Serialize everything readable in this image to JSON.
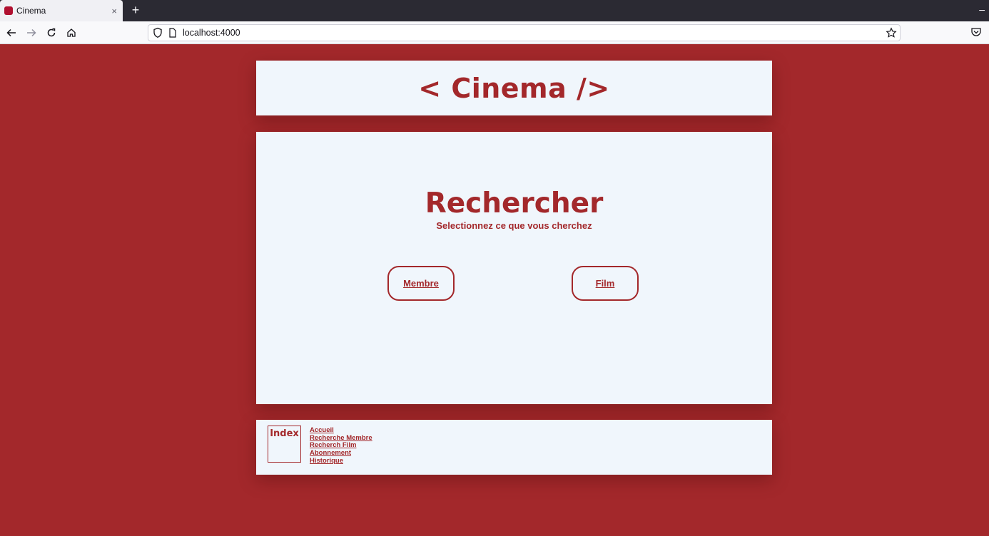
{
  "browser": {
    "tab_title": "Cinema",
    "tab_close": "×",
    "new_tab": "+",
    "minimize": "–",
    "url": "localhost:4000",
    "icons": [
      "back-icon",
      "forward-icon",
      "reload-icon",
      "home-icon",
      "shield-icon",
      "page-icon",
      "star-icon",
      "pocket-icon"
    ]
  },
  "header": {
    "title": "< Cinema />"
  },
  "main": {
    "heading": "Rechercher",
    "subtitle": "Selectionnez ce que vous cherchez",
    "buttons": {
      "membre": "Membre",
      "film": "Film"
    }
  },
  "footer": {
    "index_label": "Index",
    "links": [
      "Accueil",
      "Recherche Membre",
      "Recherch Film",
      "Abonnement",
      "Historique"
    ]
  },
  "colors": {
    "accent": "#a3282b",
    "panel": "#f0f6fc"
  }
}
